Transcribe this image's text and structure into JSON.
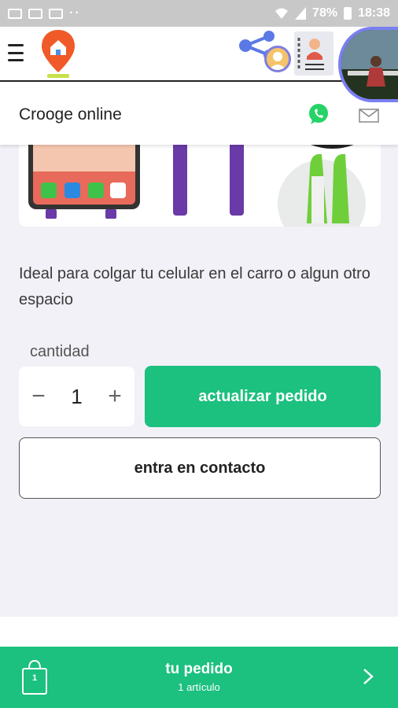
{
  "status_bar": {
    "battery": "78%",
    "time": "18:38"
  },
  "app_bar": {
    "menu_icon": "hamburger-icon",
    "logo_icon": "location-pin-home-icon",
    "share_icon": "share-icon"
  },
  "store": {
    "title": "Crooge online",
    "whatsapp_icon": "whatsapp-icon",
    "mail_icon": "mail-icon"
  },
  "product": {
    "description": "Ideal para colgar tu celular  en el carro o algun otro espacio",
    "quantity_label": "cantidad",
    "quantity": "1",
    "minus_label": "−",
    "plus_label": "+",
    "update_button": "actualizar pedido",
    "contact_button": "entra en contacto"
  },
  "order_bar": {
    "title": "tu pedido",
    "subtitle": "1 artículo",
    "bag_count": "1"
  },
  "colors": {
    "accent": "#1cc07f",
    "background": "#f1f1f7",
    "status_bar": "#c8c8c8"
  }
}
